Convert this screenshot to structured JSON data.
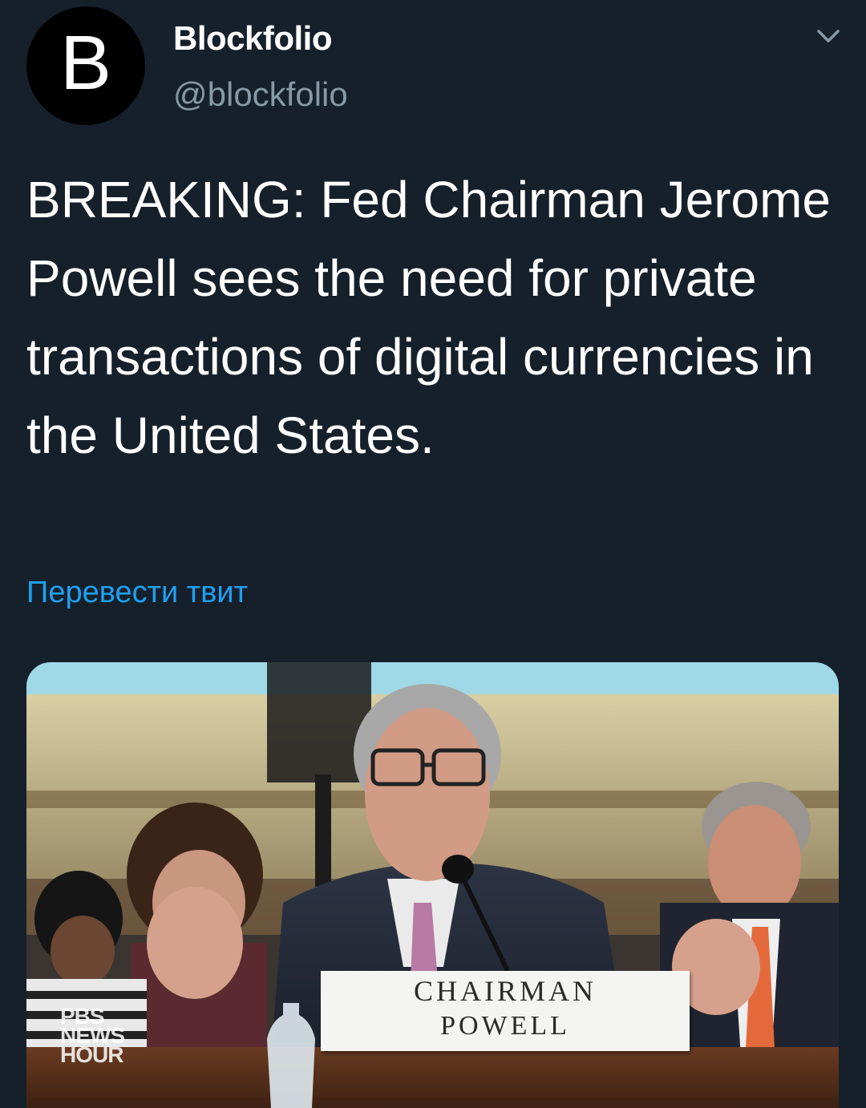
{
  "author": {
    "avatar_letter": "B",
    "display_name": "Blockfolio",
    "handle": "@blockfolio"
  },
  "tweet": {
    "text": "BREAKING: Fed Chairman Jerome Powell sees the need for private transactions of digital currencies in the United States.",
    "translate_label": "Перевести твит"
  },
  "media": {
    "nameplate_line1": "CHAIRMAN",
    "nameplate_line2": "POWELL",
    "broadcaster_logo_lines": [
      "PBS",
      "NEWS",
      "HOUR"
    ]
  },
  "icons": {
    "more": "chevron-down-icon"
  },
  "colors": {
    "background": "#15202b",
    "secondary_text": "#8899a6",
    "link": "#1da1f2"
  }
}
